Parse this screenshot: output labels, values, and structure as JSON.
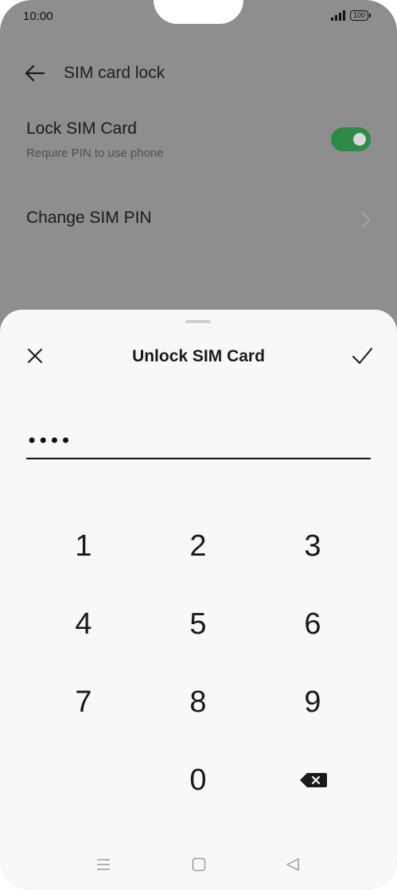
{
  "status_bar": {
    "time": "10:00",
    "battery": "100"
  },
  "app_bar": {
    "title": "SIM card lock",
    "back_icon": "arrow-left-icon"
  },
  "settings": {
    "lock_sim": {
      "title": "Lock SIM Card",
      "subtitle": "Require PIN to use phone",
      "enabled": true
    },
    "change_pin": {
      "title": "Change SIM PIN"
    }
  },
  "dialog": {
    "title": "Unlock SIM Card",
    "close_icon": "close-icon",
    "confirm_icon": "check-icon",
    "pin_value": "••••"
  },
  "keypad": {
    "keys": [
      "1",
      "2",
      "3",
      "4",
      "5",
      "6",
      "7",
      "8",
      "9",
      "0"
    ],
    "backspace_icon": "backspace-icon"
  },
  "nav_bar": {
    "icons": [
      "menu-icon",
      "home-icon",
      "back-icon"
    ]
  },
  "colors": {
    "toggle_on": "#2e8b46",
    "scrim": "#8e8e8e",
    "sheet": "#f8f8f8"
  }
}
